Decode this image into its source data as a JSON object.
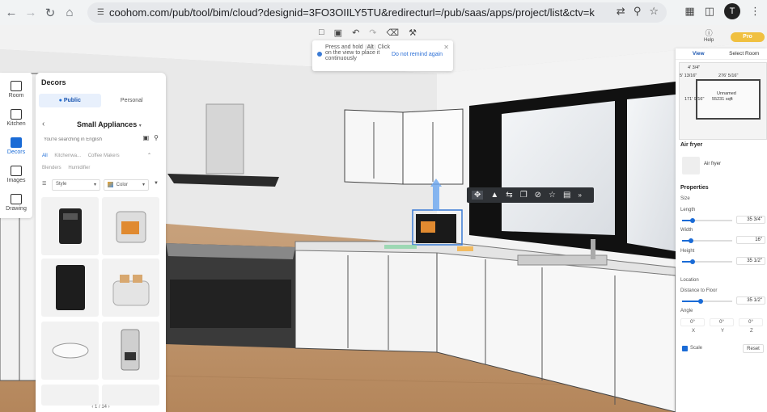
{
  "browser": {
    "url": "coohom.com/pub/tool/bim/cloud?designid=3FO3OIILY5TU&redirecturl=/pub/saas/apps/project/list&ctv=kb&locale=...",
    "avatar_letter": "T"
  },
  "tooltip": {
    "line1": "Press and hold",
    "key": "Alt",
    "line1_end": "Click",
    "line2": "on the view to place it",
    "line3": "continuously",
    "dont_remind": "Do not remind again"
  },
  "left_nav": {
    "items": [
      {
        "label": "Room"
      },
      {
        "label": "Kitchen"
      },
      {
        "label": "Decors"
      },
      {
        "label": "Images"
      },
      {
        "label": "Drawing"
      }
    ]
  },
  "decors": {
    "title": "Decors",
    "tab_public": "Public",
    "tab_personal": "Personal",
    "category": "Small Appliances",
    "search_placeholder": "You're searching in English",
    "filters": [
      "All",
      "Kitchenwa...",
      "Coffee Makers",
      "Blenders",
      "Humidifier"
    ],
    "style_label": "Style",
    "color_label": "Color",
    "pager": "1 / 14"
  },
  "header_right": {
    "help": "Help",
    "pro": "Pro"
  },
  "right_panel": {
    "tab_view": "View",
    "tab_select_room": "Select Room",
    "minimap": {
      "dim_top": "4' 3/4\"",
      "dim_left": "5' 13/16\"",
      "dim_mid": "276' 5/16\"",
      "dim_side": "171' 9/16\"",
      "room_name": "Unnamed",
      "room_area": "55231 sqft"
    },
    "item_title": "Air fryer",
    "item_name": "Air fryer",
    "properties_title": "Properties",
    "size_label": "Size",
    "length_label": "Length",
    "length_value": "35 3/4\"",
    "width_label": "Width",
    "width_value": "16\"",
    "height_label": "Height",
    "height_value": "35 1/2\"",
    "location_label": "Location",
    "distance_label": "Distance to Floor",
    "distance_value": "35 1/2\"",
    "angle_label": "Angle",
    "angle_x": "0°",
    "angle_y": "0°",
    "angle_z": "0°",
    "axis_x": "X",
    "axis_y": "Y",
    "axis_z": "Z",
    "scale_label": "Scale",
    "reset_label": "Reset"
  }
}
